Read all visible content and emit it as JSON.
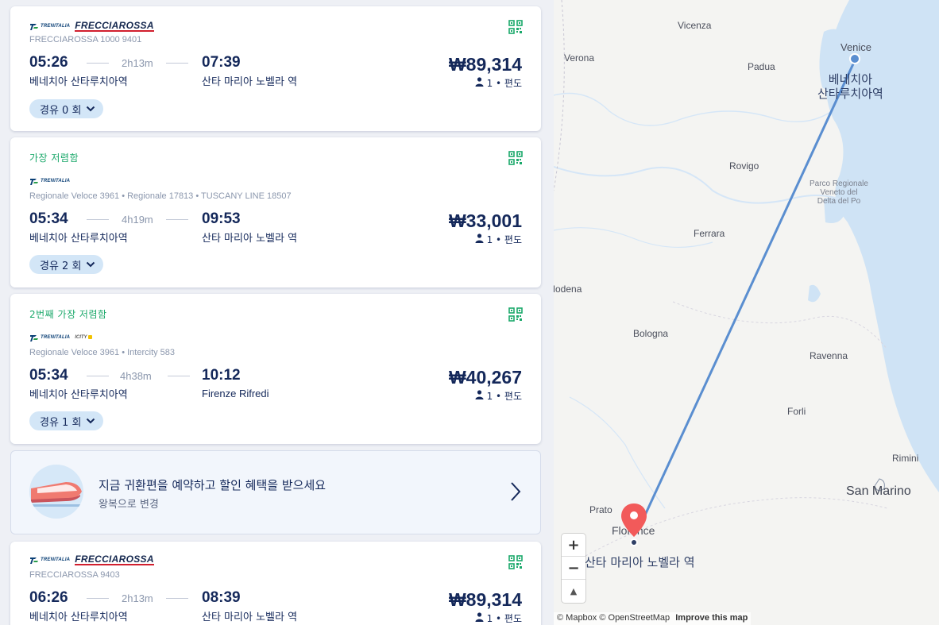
{
  "results": [
    {
      "badge": "",
      "logo": "frecciarossa",
      "trenitalia_text": "TRENITALIA",
      "brand_text": "FRECCIAROSSA",
      "train": "FRECCIAROSSA 1000 9401",
      "depart_time": "05:26",
      "duration": "2h13m",
      "arrive_time": "07:39",
      "from_station": "베네치아 산타루치아역",
      "to_station": "산타 마리아 노벨라 역",
      "price": "₩89,314",
      "passengers": "1 • 편도",
      "stops": "경유 0 회"
    },
    {
      "badge": "가장 저렴함",
      "logo": "trenitalia",
      "trenitalia_text": "TRENITALIA",
      "brand_text": "",
      "train": "Regionale Veloce 3961 • Regionale 17813 • TUSCANY LINE 18507",
      "depart_time": "05:34",
      "duration": "4h19m",
      "arrive_time": "09:53",
      "from_station": "베네치아 산타루치아역",
      "to_station": "산타 마리아 노벨라 역",
      "price": "₩33,001",
      "passengers": "1 • 편도",
      "stops": "경유 2 회"
    },
    {
      "badge": "2번째 가장 저렴함",
      "logo": "trenitalia-intercity",
      "trenitalia_text": "TRENITALIA",
      "brand_text": "ICITY",
      "train": "Regionale Veloce 3961 • Intercity 583",
      "depart_time": "05:34",
      "duration": "4h38m",
      "arrive_time": "10:12",
      "from_station": "베네치아 산타루치아역",
      "to_station": "Firenze Rifredi",
      "price": "₩40,267",
      "passengers": "1 • 편도",
      "stops": "경유 1 회"
    },
    {
      "badge": "",
      "logo": "frecciarossa",
      "trenitalia_text": "TRENITALIA",
      "brand_text": "FRECCIAROSSA",
      "train": "FRECCIAROSSA 9403",
      "depart_time": "06:26",
      "duration": "2h13m",
      "arrive_time": "08:39",
      "from_station": "베네치아 산타루치아역",
      "to_station": "산타 마리아 노벨라 역",
      "price": "₩89,314",
      "passengers": "1 • 편도",
      "stops": ""
    }
  ],
  "promo": {
    "title": "지금 귀환편을 예약하고 할인 혜택을 받으세요",
    "subtitle": "왕복으로 변경"
  },
  "map": {
    "cities": {
      "vicenza": "Vicenza",
      "verona": "Verona",
      "padua": "Padua",
      "venice": "Venice",
      "rovigo": "Rovigo",
      "parco": "Parco Regionale\nVeneto del\nDelta del Po",
      "ferrara": "Ferrara",
      "modena": "Modena",
      "bologna": "Bologna",
      "ravenna": "Ravenna",
      "forli": "Forli",
      "rimini": "Rimini",
      "san_marino": "San Marino",
      "prato": "Prato",
      "florence": "Florence"
    },
    "origin_label_1": "베네치아",
    "origin_label_2": "산타루치아역",
    "dest_label": "산타 마리아 노벨라 역",
    "zoom_in": "+",
    "zoom_out": "−",
    "compass": "▲",
    "attribution": "© Mapbox © OpenStreetMap",
    "improve": "Improve this map"
  },
  "colors": {
    "accent_green": "#1aa86a",
    "navy": "#14285a",
    "route_blue": "#5a8ed0",
    "pin_red": "#f25a5a",
    "water": "#cfe3f5"
  }
}
